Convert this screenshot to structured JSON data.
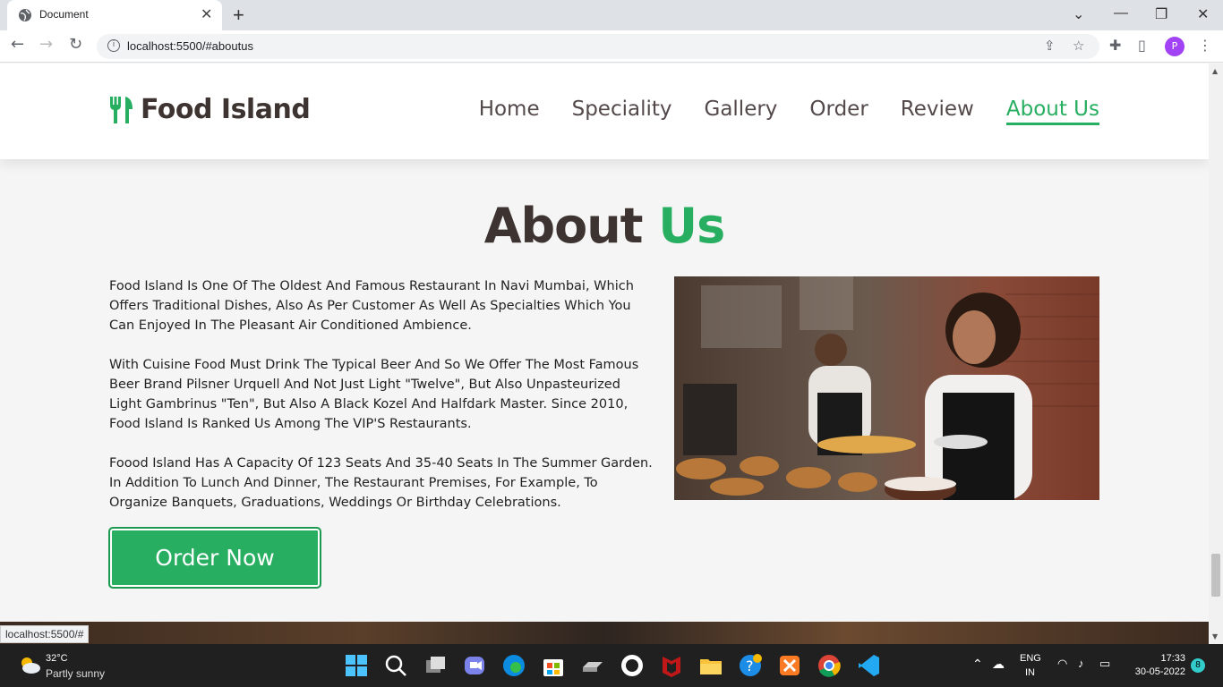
{
  "browser": {
    "tab_title": "Document",
    "url": "localhost:5500/#aboutus",
    "status_url": "localhost:5500/#",
    "profile_initial": "P"
  },
  "site": {
    "logo_text": "Food Island",
    "nav": [
      {
        "label": "Home",
        "active": false
      },
      {
        "label": "Speciality",
        "active": false
      },
      {
        "label": "Gallery",
        "active": false
      },
      {
        "label": "Order",
        "active": false
      },
      {
        "label": "Review",
        "active": false
      },
      {
        "label": "About Us",
        "active": true
      }
    ],
    "accent_color": "#27ae60",
    "dark_color": "#3d3331"
  },
  "about": {
    "heading_main": "About ",
    "heading_accent": "Us",
    "paragraphs": [
      "Food Island Is One Of The Oldest And Famous Restaurant In Navi Mumbai, Which Offers Traditional Dishes, Also As Per Customer As Well As Specialties Which You Can Enjoyed In The Pleasant Air Conditioned Ambience.",
      "With Cuisine Food Must Drink The Typical Beer And So We Offer The Most Famous Beer Brand Pilsner Urquell And Not Just Light \"Twelve\", But Also Unpasteurized Light Gambrinus \"Ten\", But Also A Black Kozel And Halfdark Master. Since 2010, Food Island Is Ranked Us Among The VIP'S Restaurants.",
      "Foood Island Has A Capacity Of 123 Seats And 35-40 Seats In The Summer Garden. In Addition To Lunch And Dinner, The Restaurant Premises, For Example, To Organize Banquets, Graduations, Weddings Or Birthday Celebrations."
    ],
    "order_button": "Order Now"
  },
  "taskbar": {
    "temperature": "32°C",
    "weather": "Partly sunny",
    "lang_line1": "ENG",
    "lang_line2": "IN",
    "time": "17:33",
    "date": "30-05-2022",
    "notifications": "8"
  }
}
